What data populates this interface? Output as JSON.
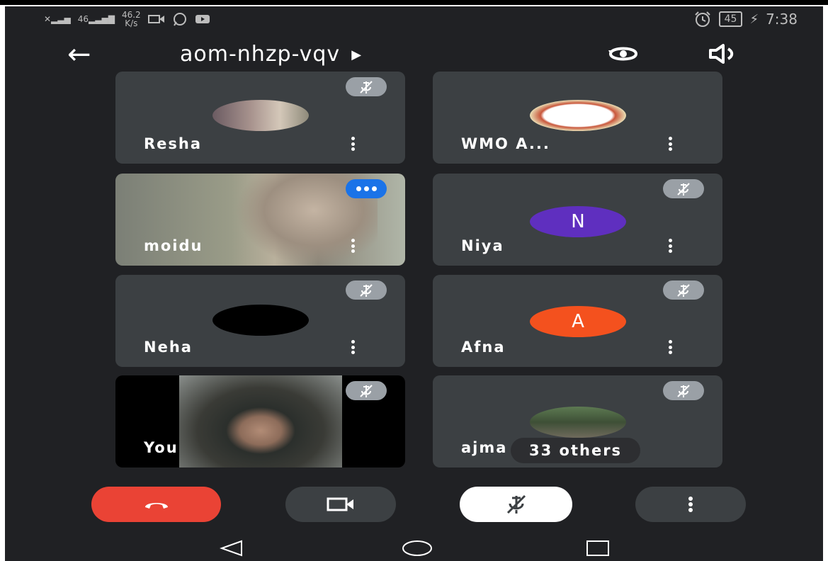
{
  "status_bar": {
    "signal1": "46",
    "speed_value": "46.2",
    "speed_unit": "K/s",
    "battery": "45",
    "time": "7:38"
  },
  "header": {
    "back_icon": "arrow-left-icon",
    "meeting_code": "aom-nhzp-vqv",
    "dropdown_icon": "triangle-right-icon",
    "switch_camera_icon": "switch-camera-icon",
    "audio_icon": "speaker-icon"
  },
  "participants": [
    {
      "name": "Resha",
      "muted": true,
      "avatar": "photo"
    },
    {
      "name": "WMO A...",
      "muted": false,
      "avatar": "logo"
    },
    {
      "name": "moidu",
      "muted": false,
      "speaking": true,
      "avatar": "video"
    },
    {
      "name": "Niya",
      "muted": true,
      "avatar": "letter",
      "letter": "N",
      "color": "#5f2fbf"
    },
    {
      "name": "Neha",
      "muted": true,
      "avatar": "black"
    },
    {
      "name": "Afna",
      "muted": true,
      "avatar": "letter",
      "letter": "A",
      "color": "#f4511e"
    },
    {
      "name": "You",
      "muted": true,
      "avatar": "video"
    },
    {
      "name": "ajma",
      "others_label": "33 others",
      "muted": true,
      "avatar": "photo"
    }
  ],
  "controls": {
    "end_call_icon": "phone-hangup-icon",
    "camera_icon": "video-camera-icon",
    "mic_icon": "mic-off-icon",
    "more_icon": "more-vertical-icon"
  },
  "colors": {
    "background": "#202124",
    "tile": "#3c4043",
    "end_call": "#ea4335",
    "speaking": "#1a73e8"
  }
}
